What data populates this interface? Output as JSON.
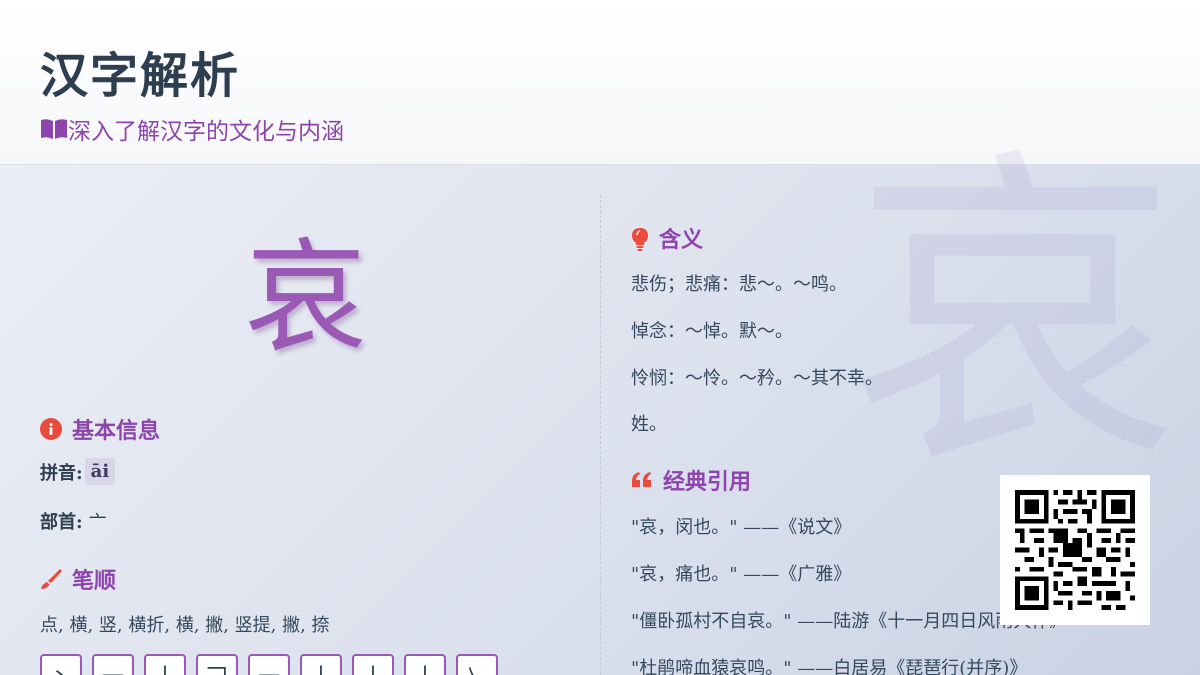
{
  "header": {
    "title": "汉字解析",
    "subtitle": "深入了解汉字的文化与内涵"
  },
  "character": "哀",
  "basic_info": {
    "title": "基本信息",
    "pinyin_label": "拼音:",
    "pinyin": "āi",
    "radical_label": "部首:",
    "radical": "亠"
  },
  "strokes": {
    "title": "笔顺",
    "order": "点, 横, 竖, 横折, 横, 撇, 竖提, 撇, 捺",
    "glyphs": [
      "丶",
      "一",
      "丨",
      "𠃍",
      "一",
      "丨",
      "丨",
      "丨",
      "乀"
    ]
  },
  "meaning": {
    "title": "含义",
    "items": [
      "悲伤；悲痛：悲～。～鸣。",
      "悼念：～悼。默～。",
      "怜悯：～怜。～矜。～其不幸。",
      "姓。"
    ]
  },
  "quotes": {
    "title": "经典引用",
    "items": [
      "\"哀，闵也。\" ——《说文》",
      "\"哀，痛也。\" ——《广雅》",
      "\"僵卧孤村不自哀。\" ——陆游《十一月四日风雨大作》",
      "\"杜鹃啼血猿哀鸣。\" ——白居易《琵琶行(并序)》"
    ]
  },
  "icons": {
    "subtitle": "book-open-icon",
    "basic_info": "info-circle-icon",
    "strokes": "brush-icon",
    "meaning": "lightbulb-icon",
    "quotes": "quote-left-icon"
  },
  "colors": {
    "accent": "#8e44ad",
    "character": "#9b59b6",
    "icon": "#e74c3c",
    "title": "#2c3e50"
  }
}
